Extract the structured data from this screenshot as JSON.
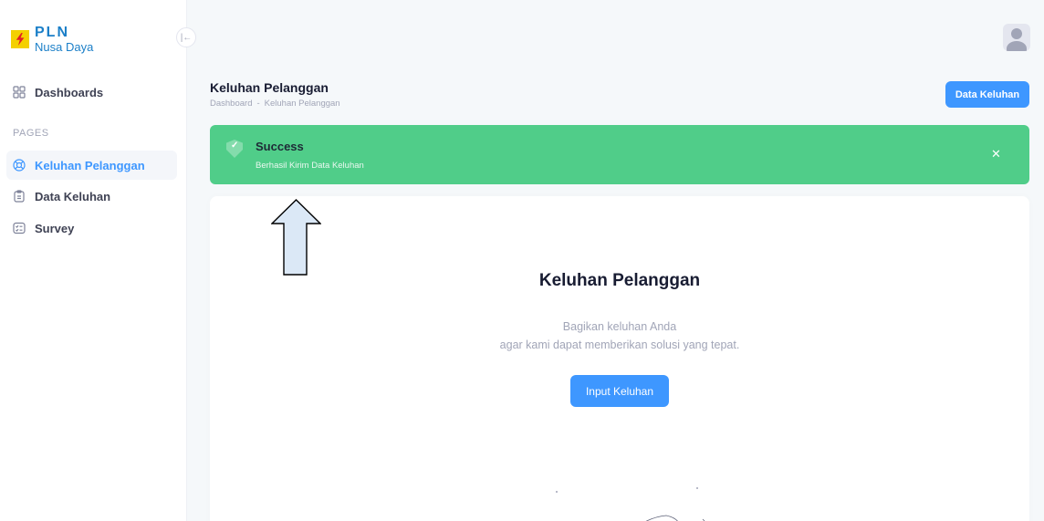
{
  "brand": {
    "name": "PLN",
    "sub": "Nusa Daya"
  },
  "sidebar": {
    "collapse_icon": "collapse-left-icon",
    "dashboards": {
      "label": "Dashboards",
      "icon": "grid-icon"
    },
    "section_label": "PAGES",
    "items": [
      {
        "label": "Keluhan Pelanggan",
        "icon": "support-icon",
        "active": true
      },
      {
        "label": "Data Keluhan",
        "icon": "clipboard-icon",
        "active": false
      },
      {
        "label": "Survey",
        "icon": "checklist-icon",
        "active": false
      }
    ]
  },
  "header": {
    "title": "Keluhan Pelanggan",
    "breadcrumb": [
      "Dashboard",
      "-",
      "Keluhan Pelanggan"
    ],
    "action_button": "Data Keluhan",
    "avatar_icon": "user-avatar-icon"
  },
  "alert": {
    "title": "Success",
    "message": "Berhasil Kirim Data Keluhan",
    "close_glyph": "✕",
    "check_glyph": "✓",
    "color": "#50cd89"
  },
  "card": {
    "title": "Keluhan Pelanggan",
    "desc_line1": "Bagikan keluhan Anda",
    "desc_line2": "agar kami dapat memberikan solusi yang tepat.",
    "button": "Input Keluhan"
  },
  "colors": {
    "primary": "#3e97ff",
    "success": "#50cd89"
  }
}
